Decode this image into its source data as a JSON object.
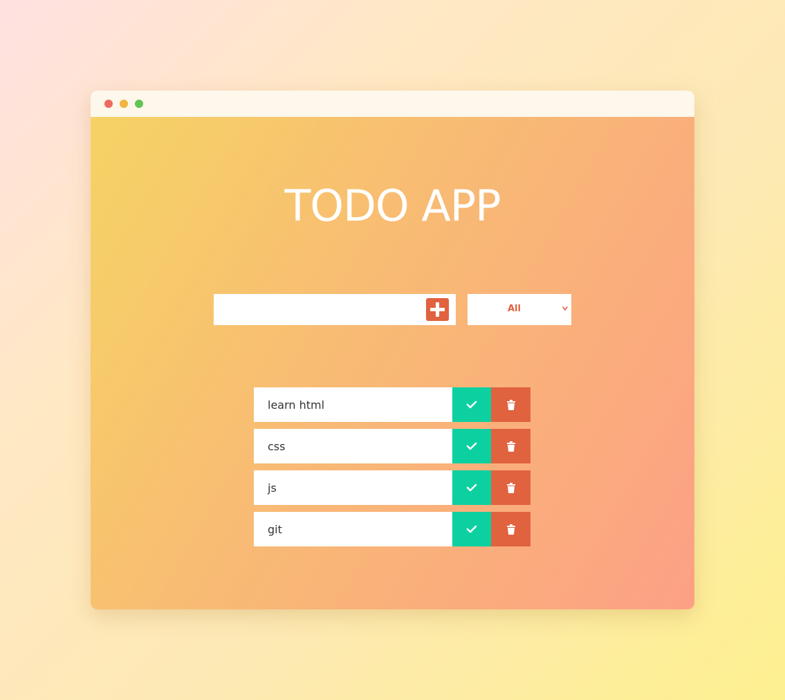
{
  "window": {
    "controls": [
      "close",
      "minimize",
      "maximize"
    ]
  },
  "app": {
    "title": "TODO APP"
  },
  "form": {
    "input_value": "",
    "add_icon": "plus-square-icon"
  },
  "filter": {
    "selected": "All",
    "icon": "chevron-down-icon"
  },
  "todos": [
    {
      "text": "learn html"
    },
    {
      "text": "css"
    },
    {
      "text": "js"
    },
    {
      "text": "git"
    }
  ],
  "actions": {
    "complete_icon": "check-icon",
    "delete_icon": "trash-icon"
  },
  "colors": {
    "accent": "#e0623f",
    "complete": "#0dd0a0",
    "gradient_start": "#f6d365",
    "gradient_end": "#fda085"
  }
}
